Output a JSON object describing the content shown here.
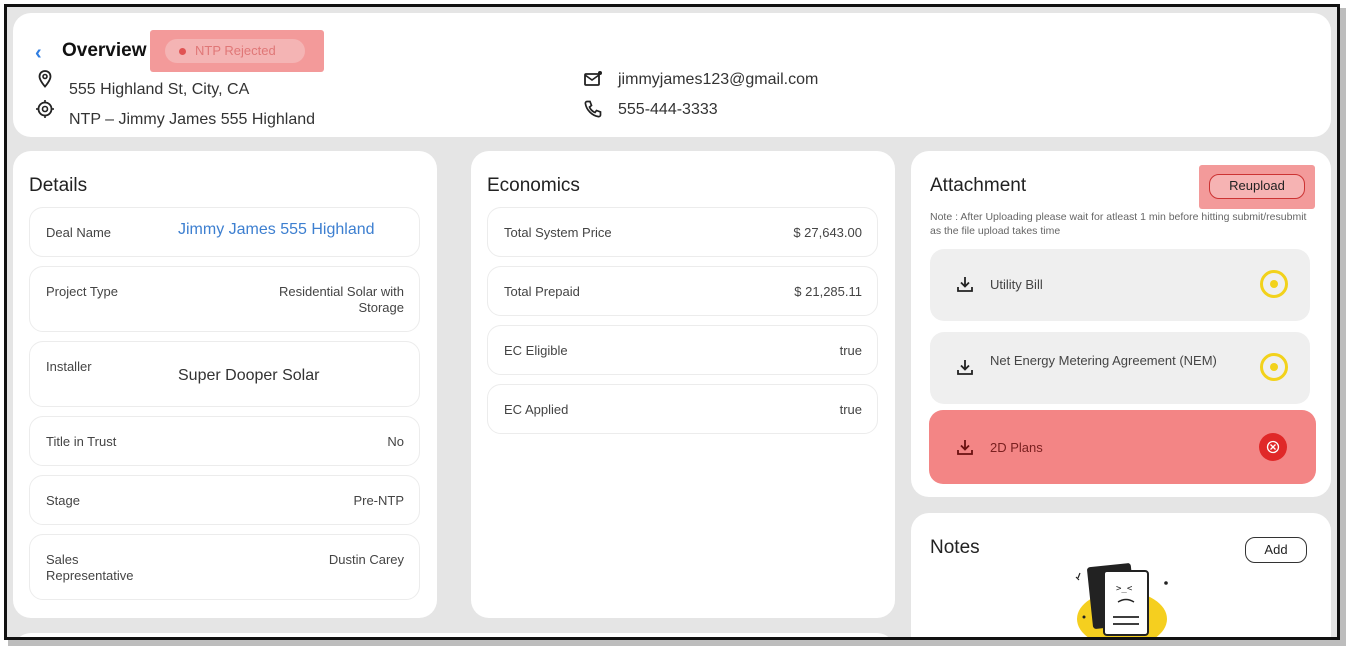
{
  "header": {
    "title": "Overview",
    "status": "NTP Rejected",
    "address": "555 Highland St, City, CA",
    "project": "NTP – Jimmy James 555 Highland",
    "email": "jimmyjames123@gmail.com",
    "phone": "555-444-3333"
  },
  "details": {
    "title": "Details",
    "rows": [
      {
        "label": "Deal Name",
        "value": "Jimmy James 555 Highland"
      },
      {
        "label": "Project Type",
        "value": "Residential Solar with Storage"
      },
      {
        "label": "Installer",
        "value": "Super Dooper Solar"
      },
      {
        "label": "Title in Trust",
        "value": "No"
      },
      {
        "label": "Stage",
        "value": "Pre-NTP"
      },
      {
        "label": "Sales Representative",
        "value": "Dustin Carey"
      }
    ]
  },
  "economics": {
    "title": "Economics",
    "rows": [
      {
        "label": "Total System Price",
        "value": "$ 27,643.00"
      },
      {
        "label": "Total Prepaid",
        "value": "$ 21,285.11"
      },
      {
        "label": "EC Eligible",
        "value": "true"
      },
      {
        "label": "EC Applied",
        "value": "true"
      }
    ]
  },
  "attachment": {
    "title": "Attachment",
    "reupload_label": "Reupload",
    "note": "Note : After Uploading please wait for atleast 1 min before hitting submit/resubmit as the file upload takes time",
    "items": [
      {
        "label": "Utility Bill",
        "status": "pending"
      },
      {
        "label": "Net Energy Metering Agreement (NEM)",
        "status": "pending"
      },
      {
        "label": "2D Plans",
        "status": "rejected"
      }
    ]
  },
  "notes": {
    "title": "Notes",
    "add_label": "Add"
  },
  "colors": {
    "accent": "#2f7de1",
    "rejected": "#e02828",
    "highlight": "#f39a9a",
    "pending": "#f2d21b"
  }
}
